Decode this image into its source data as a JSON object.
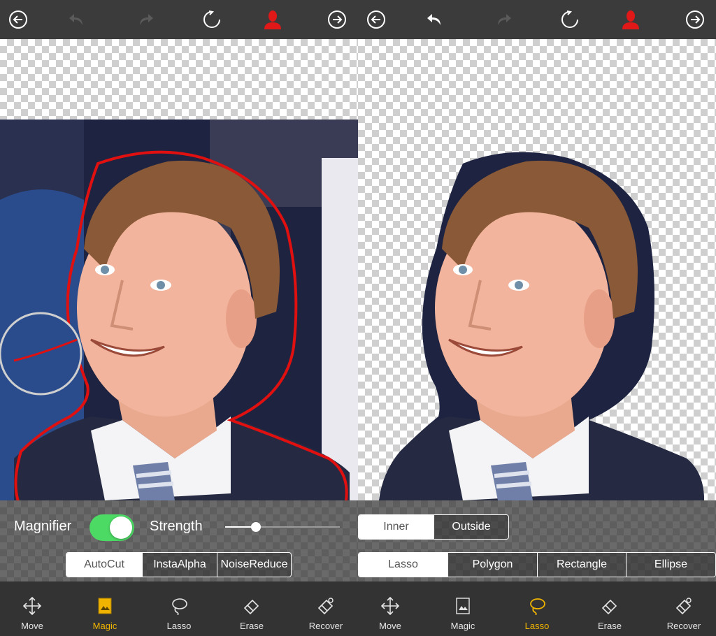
{
  "topbar": {
    "back_icon": "arrow-left-circle-icon",
    "undo_icon": "undo-icon",
    "redo_icon": "redo-icon",
    "reset_icon": "reset-icon",
    "person_icon": "person-icon",
    "forward_icon": "arrow-right-circle-icon",
    "accent_color": "#e01818"
  },
  "left_panel": {
    "magnifier_label": "Magnifier",
    "magnifier_on": true,
    "strength_label": "Strength",
    "strength_value": 0.27,
    "modes": [
      {
        "label": "AutoCut",
        "selected": true
      },
      {
        "label": "InstaAlpha",
        "selected": false
      },
      {
        "label": "NoiseReduce",
        "selected": false
      }
    ]
  },
  "right_panel": {
    "region_options": [
      {
        "label": "Inner",
        "selected": true
      },
      {
        "label": "Outside",
        "selected": false
      }
    ],
    "lasso_shapes": [
      {
        "label": "Lasso",
        "selected": true
      },
      {
        "label": "Polygon",
        "selected": false
      },
      {
        "label": "Rectangle",
        "selected": false
      },
      {
        "label": "Ellipse",
        "selected": false
      }
    ]
  },
  "left_toolbar": [
    {
      "label": "Move",
      "icon": "move-icon",
      "active": false
    },
    {
      "label": "Magic",
      "icon": "magic-icon",
      "active": true
    },
    {
      "label": "Lasso",
      "icon": "lasso-icon",
      "active": false
    },
    {
      "label": "Erase",
      "icon": "eraser-icon",
      "active": false
    },
    {
      "label": "Recover",
      "icon": "recover-icon",
      "active": false
    }
  ],
  "right_toolbar": [
    {
      "label": "Move",
      "icon": "move-icon",
      "active": false
    },
    {
      "label": "Magic",
      "icon": "magic-icon",
      "active": false
    },
    {
      "label": "Lasso",
      "icon": "lasso-icon",
      "active": true
    },
    {
      "label": "Erase",
      "icon": "eraser-icon",
      "active": false
    },
    {
      "label": "Recover",
      "icon": "recover-icon",
      "active": false
    }
  ],
  "colors": {
    "active_tool": "#f0b400",
    "toggle_on": "#4cd964",
    "selection_stroke": "#e01010"
  }
}
